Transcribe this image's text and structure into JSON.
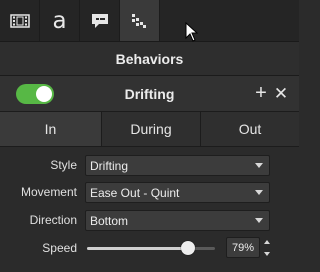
{
  "toolbar": {
    "tabs": [
      {
        "icon": "film-strip-icon"
      },
      {
        "icon": "annotations-icon",
        "glyph": "a"
      },
      {
        "icon": "caption-icon"
      },
      {
        "icon": "behaviors-icon"
      }
    ],
    "active_tab": "behaviors"
  },
  "panel": {
    "title": "Behaviors"
  },
  "behavior": {
    "name": "Drifting",
    "enabled": true,
    "accent_color": "#57b845"
  },
  "phases": {
    "tabs": [
      "In",
      "During",
      "Out"
    ],
    "selected": "In"
  },
  "properties": {
    "style": {
      "label": "Style",
      "value": "Drifting"
    },
    "movement": {
      "label": "Movement",
      "value": "Ease Out - Quint"
    },
    "direction": {
      "label": "Direction",
      "value": "Bottom"
    },
    "speed": {
      "label": "Speed",
      "value": "79%",
      "fraction": 0.79
    }
  }
}
